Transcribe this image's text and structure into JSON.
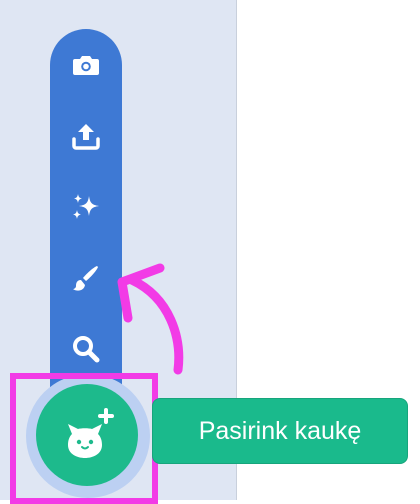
{
  "colors": {
    "sidebar_bg": "#dfe6f3",
    "toolbar_bg": "#3e79d4",
    "fab_bg": "#1dba8c",
    "fab_halo": "#bcd0f2",
    "highlight": "#f23be6",
    "tooltip_bg": "#1aba8c",
    "arrow": "#f23be6"
  },
  "toolbar": {
    "items": [
      {
        "icon": "camera-icon"
      },
      {
        "icon": "upload-icon"
      },
      {
        "icon": "sparkles-icon"
      },
      {
        "icon": "paintbrush-icon"
      },
      {
        "icon": "search-icon"
      }
    ]
  },
  "fab": {
    "icon": "cat-add-icon"
  },
  "tooltip": {
    "label": "Pasirink kaukę"
  },
  "annotation": {
    "arrow_icon": "hand-drawn-arrow-icon"
  }
}
